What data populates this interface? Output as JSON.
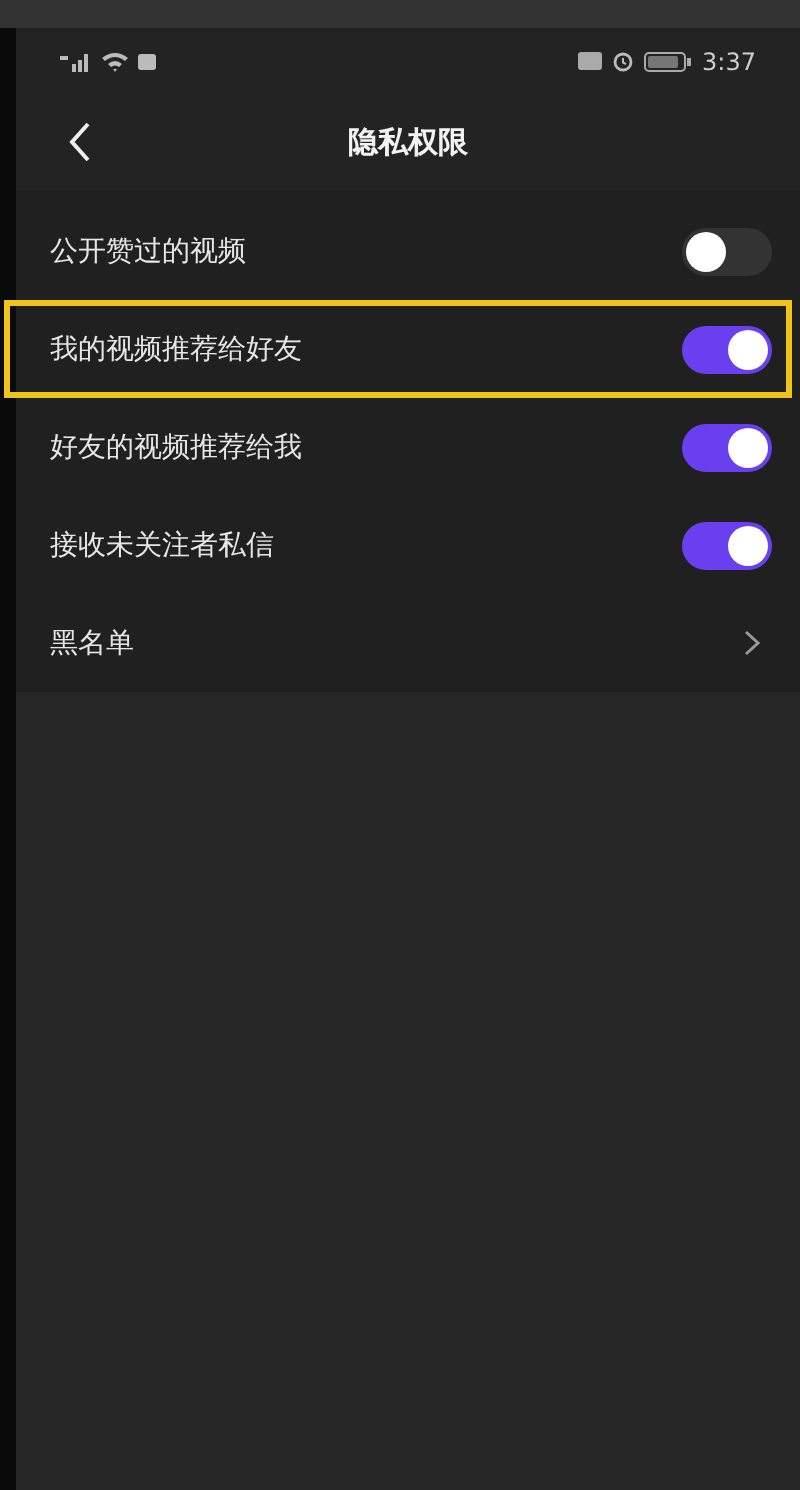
{
  "status_bar": {
    "time": "3:37"
  },
  "header": {
    "title": "隐私权限"
  },
  "settings": [
    {
      "kind": "toggle",
      "label": "公开赞过的视频",
      "on": false,
      "highlighted": false
    },
    {
      "kind": "toggle",
      "label": "我的视频推荐给好友",
      "on": true,
      "highlighted": true
    },
    {
      "kind": "toggle",
      "label": "好友的视频推荐给我",
      "on": true,
      "highlighted": false
    },
    {
      "kind": "toggle",
      "label": "接收未关注者私信",
      "on": true,
      "highlighted": false
    },
    {
      "kind": "link",
      "label": "黑名单",
      "highlighted": false
    }
  ]
}
